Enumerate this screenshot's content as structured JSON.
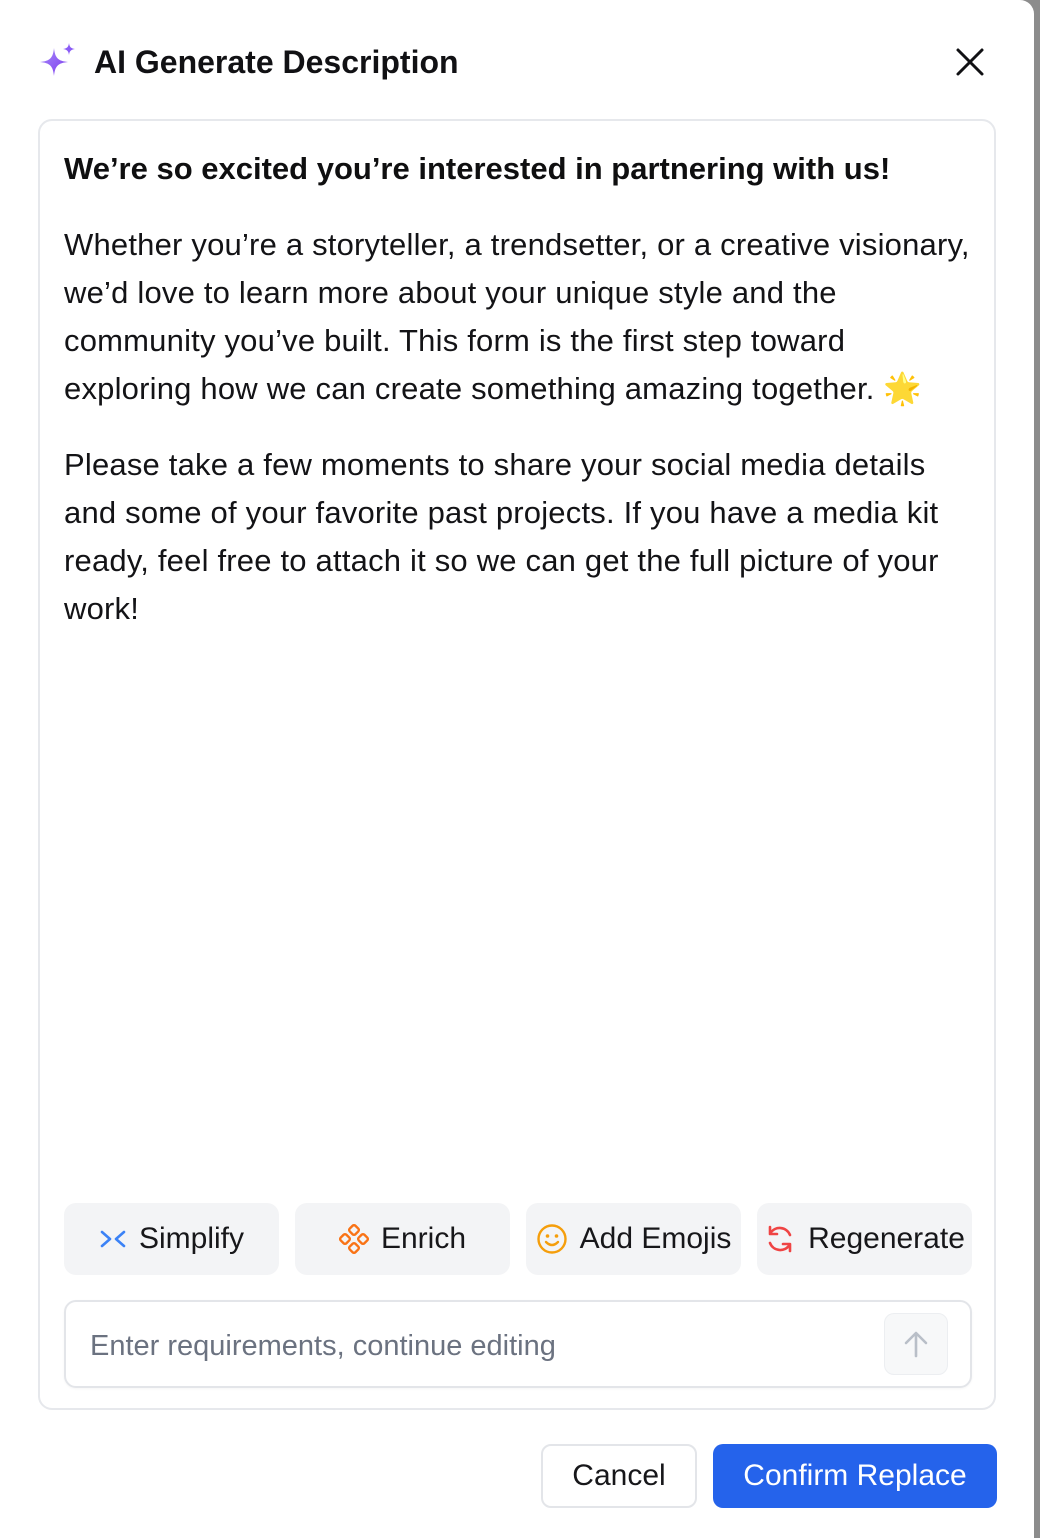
{
  "dialog": {
    "title": "AI Generate Description",
    "close_label": "Close"
  },
  "content": {
    "headline": "We’re so excited you’re interested in partnering with us!",
    "paragraphs": [
      "Whether you’re a storyteller, a trendsetter, or a creative visionary, we’d love to learn more about your unique style and the community you’ve built. This form is the first step toward exploring how we can create something amazing together. 🌟",
      "Please take a few moments to share your social media details and some of your favorite past projects. If you have a media kit ready, feel free to attach it so we can get the full picture of your work!"
    ]
  },
  "actions": [
    {
      "label": "Simplify",
      "icon": "collapse-arrows-icon",
      "color": "#3b82f6"
    },
    {
      "label": "Enrich",
      "icon": "nodes-icon",
      "color": "#f97316"
    },
    {
      "label": "Add Emojis",
      "icon": "smiley-icon",
      "color": "#f59e0b"
    },
    {
      "label": "Regenerate",
      "icon": "refresh-icon",
      "color": "#ef4444"
    }
  ],
  "prompt": {
    "placeholder": "Enter requirements, continue editing",
    "value": ""
  },
  "footer": {
    "cancel_label": "Cancel",
    "confirm_label": "Confirm Replace"
  },
  "colors": {
    "accent": "#2563eb",
    "sparkle": "#8b5cf6"
  }
}
